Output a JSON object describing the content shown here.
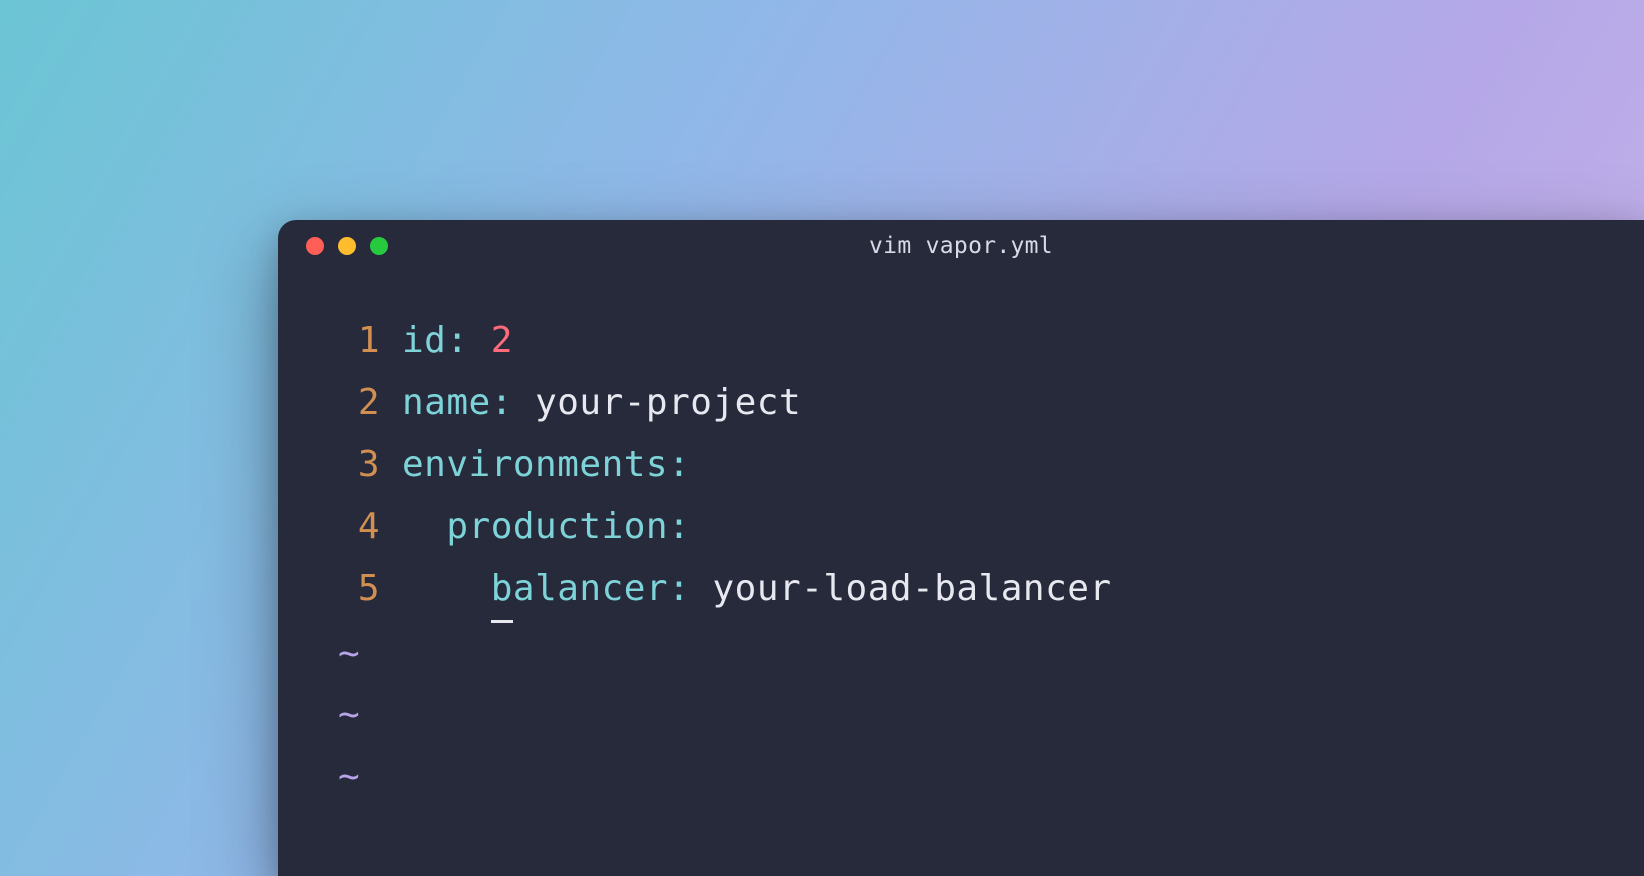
{
  "window": {
    "title": "vim vapor.yml"
  },
  "lines": [
    {
      "num": "1",
      "indent": "",
      "key": "id",
      "value": "2",
      "value_type": "num"
    },
    {
      "num": "2",
      "indent": "",
      "key": "name",
      "value": " your-project",
      "value_type": "str"
    },
    {
      "num": "3",
      "indent": "",
      "key": "environments",
      "value": "",
      "value_type": "none"
    },
    {
      "num": "4",
      "indent": "  ",
      "key": "production",
      "value": "",
      "value_type": "none"
    },
    {
      "num": "5",
      "indent": "    ",
      "key_cursor_char": "b",
      "key_rest": "alancer",
      "value": " your-load-balancer",
      "value_type": "str"
    }
  ],
  "tildes": [
    "~",
    "~",
    "~"
  ]
}
